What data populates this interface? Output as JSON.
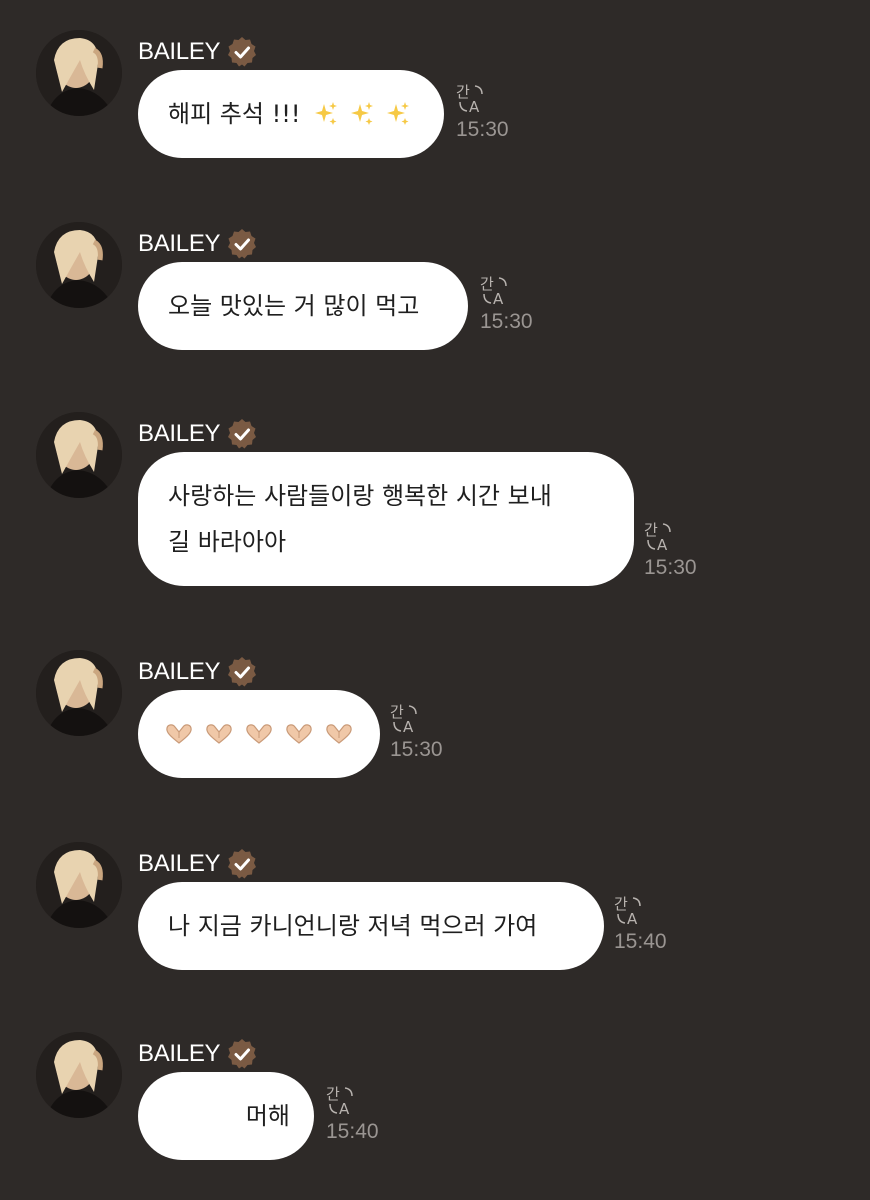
{
  "sender": "BAILEY",
  "colors": {
    "background": "#2e2a28",
    "bubble": "#ffffff",
    "badge": "#7a5a43",
    "timestamp": "#9a9592"
  },
  "icons": {
    "verified": "verified-badge-icon",
    "translate": "translate-icon",
    "sparkles": "sparkles-emoji",
    "heart_hands": "heart-hands-emoji"
  },
  "messages": [
    {
      "text": "해피 추석 !!!",
      "emoji": "sparkles",
      "emoji_count": 3,
      "time": "15:30"
    },
    {
      "text": "오늘 맛있는 거 많이 먹고",
      "time": "15:30"
    },
    {
      "text": "사랑하는 사람들이랑 행복한 시간 보내\n길 바라아아",
      "time": "15:30"
    },
    {
      "text": "",
      "emoji": "heart_hands",
      "emoji_count": 5,
      "time": "15:30"
    },
    {
      "text": "나 지금 카니언니랑 저녁 먹으러 가여",
      "time": "15:40"
    },
    {
      "text": "머해",
      "time": "15:40"
    }
  ]
}
